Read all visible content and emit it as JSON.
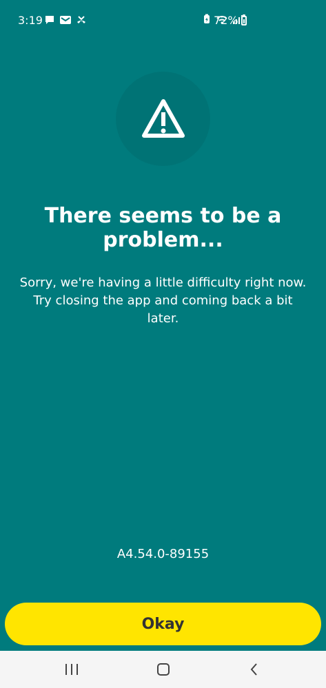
{
  "status_bar": {
    "time": "3:19",
    "battery_percent": "72%"
  },
  "icons": {
    "alert": "warning-triangle-icon",
    "message": "message-icon",
    "mail": "mail-icon",
    "missed_call": "missed-call-icon",
    "battery_saver": "battery-saver-icon",
    "wifi": "wifi-icon",
    "signal": "signal-icon",
    "battery": "battery-icon"
  },
  "error": {
    "title": "There seems to be a problem...",
    "message": "Sorry, we're having a little difficulty right now. Try closing the app and coming back a bit later.",
    "version": "A4.54.0-89155"
  },
  "actions": {
    "okay_label": "Okay"
  },
  "colors": {
    "background": "#007b7d",
    "button": "#ffe500"
  }
}
